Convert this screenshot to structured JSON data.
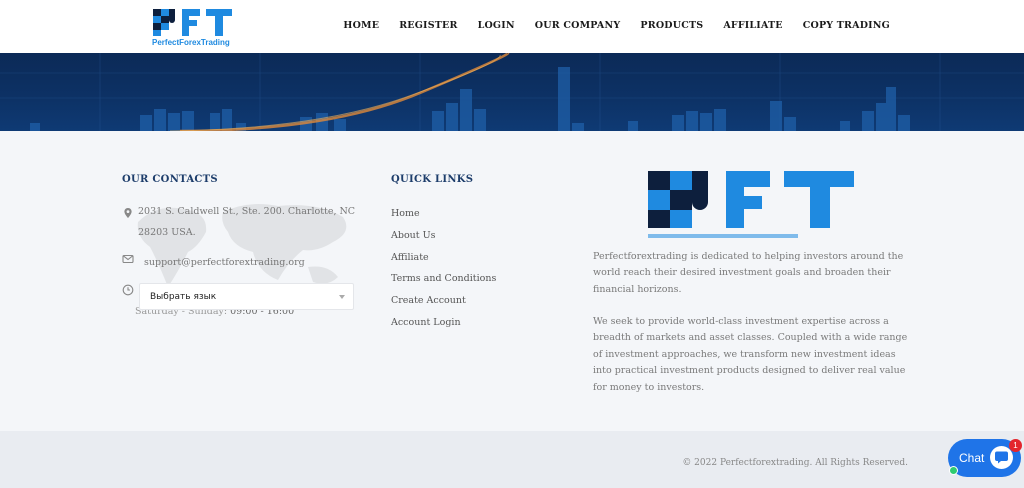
{
  "header": {
    "logo_text": "PFT",
    "logo_tagline": "PerfectForexTrading",
    "nav": [
      "HOME",
      "REGISTER",
      "LOGIN",
      "OUR COMPANY",
      "PRODUCTS",
      "AFFILIATE",
      "COPY TRADING"
    ]
  },
  "contacts": {
    "title": "OUR CONTACTS",
    "address": "2031 S. Caldwell St., Ste. 200. Charlotte, NC 28203 USA.",
    "email": "support@perfectforextrading.org",
    "language_select": "Выбрать язык",
    "hours_days": "Saturday - Sunday:",
    "hours_time": "09:00 - 16:00"
  },
  "quick_links": {
    "title": "QUICK LINKS",
    "items": [
      "Home",
      "About Us",
      "Affiliate",
      "Terms and Conditions",
      "Create Account",
      "Account Login"
    ]
  },
  "about": {
    "paragraph1": "Perfectforextrading is dedicated to helping investors around the world reach their desired investment goals and broaden their financial horizons.",
    "paragraph2": "We seek to provide world-class investment expertise across a breadth of markets and asset classes. Coupled with a wide range of investment approaches, we transform new investment ideas into practical investment products designed to deliver real value for money to investors."
  },
  "footer": {
    "copyright": "© 2022 Perfectforextrading. All Rights Reserved."
  },
  "chat": {
    "label": "Chat",
    "badge": "1"
  },
  "colors": {
    "brand_blue": "#1f8ae0",
    "brand_navy": "#0d1f3d",
    "banner_dark": "#0b2a57",
    "chat_blue": "#1f74e8",
    "badge_red": "#e3262e"
  }
}
